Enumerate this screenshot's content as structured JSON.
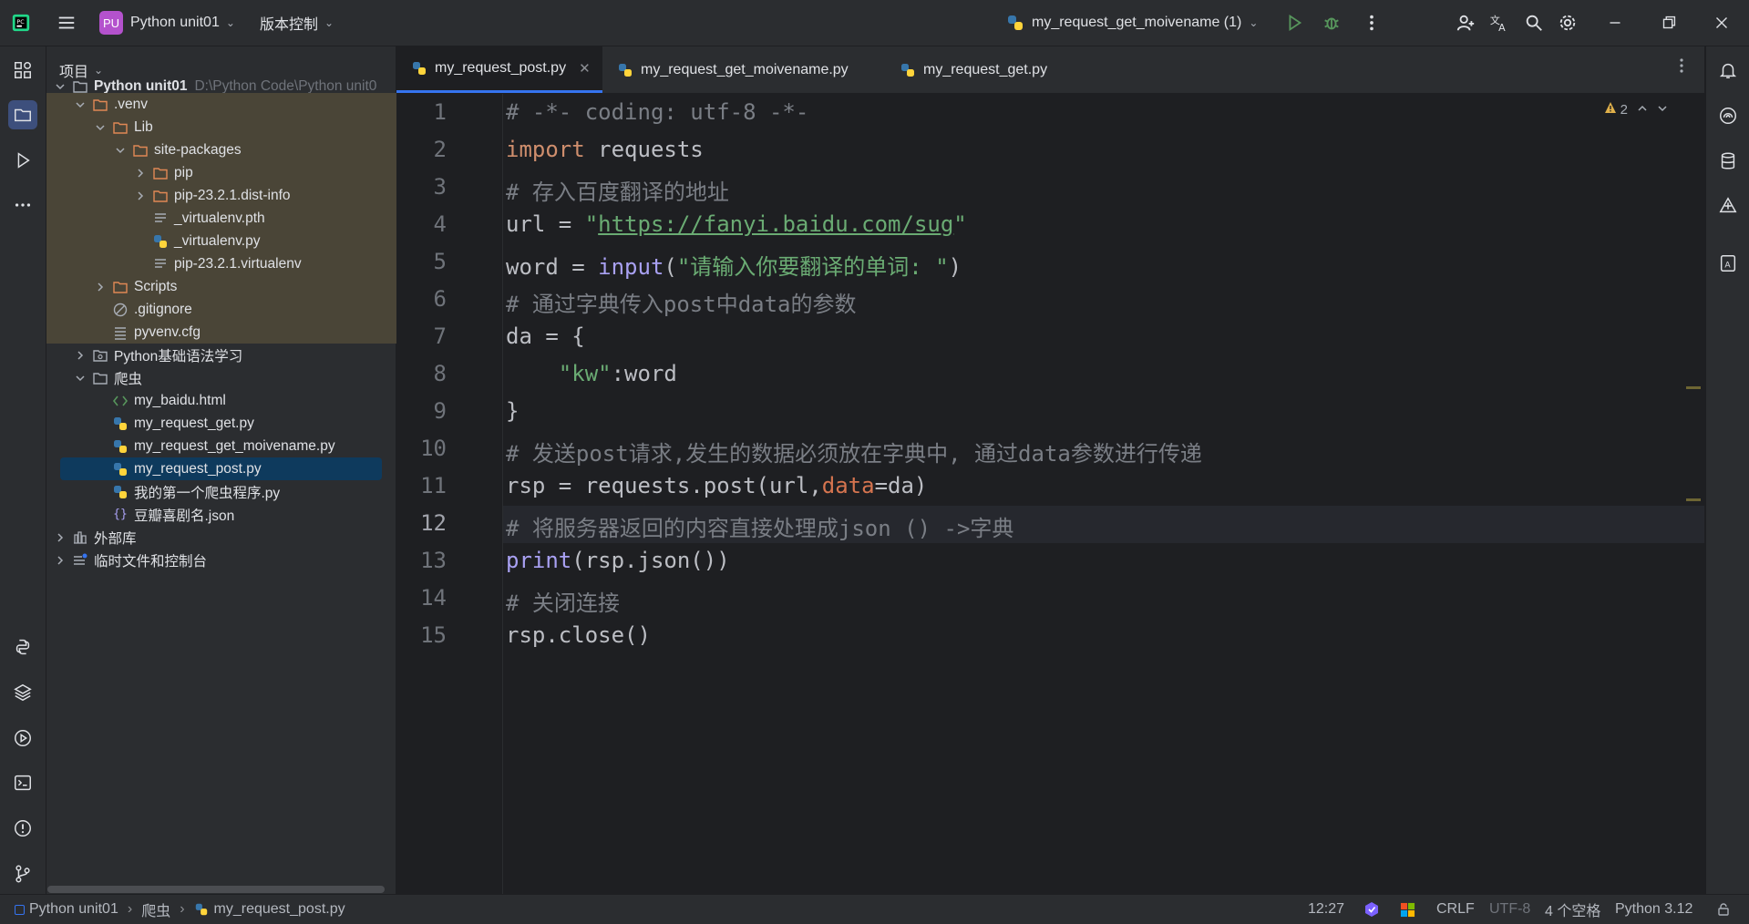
{
  "titlebar": {
    "project_badge": "PU",
    "project_name": "Python unit01",
    "vcs_label": "版本控制",
    "run_config": "my_request_get_moivename (1)"
  },
  "project_panel": {
    "title": "项目",
    "root_name": "Python unit01",
    "root_path": "D:\\Python Code\\Python unit0",
    "items": [
      {
        "label": ".venv"
      },
      {
        "label": "Lib"
      },
      {
        "label": "site-packages"
      },
      {
        "label": "pip"
      },
      {
        "label": "pip-23.2.1.dist-info"
      },
      {
        "label": "_virtualenv.pth"
      },
      {
        "label": "_virtualenv.py"
      },
      {
        "label": "pip-23.2.1.virtualenv"
      },
      {
        "label": "Scripts"
      },
      {
        "label": ".gitignore"
      },
      {
        "label": "pyvenv.cfg"
      },
      {
        "label": "Python基础语法学习"
      },
      {
        "label": "爬虫"
      },
      {
        "label": "my_baidu.html"
      },
      {
        "label": "my_request_get.py"
      },
      {
        "label": "my_request_get_moivename.py"
      },
      {
        "label": "my_request_post.py"
      },
      {
        "label": "我的第一个爬虫程序.py"
      },
      {
        "label": "豆瓣喜剧名.json"
      },
      {
        "label": "外部库"
      },
      {
        "label": "临时文件和控制台"
      }
    ]
  },
  "tabs": [
    {
      "label": "my_request_post.py"
    },
    {
      "label": "my_request_get_moivename.py"
    },
    {
      "label": "my_request_get.py"
    }
  ],
  "editor": {
    "warning_count": "2",
    "current_line": 12,
    "line_numbers": [
      "1",
      "2",
      "3",
      "4",
      "5",
      "6",
      "7",
      "8",
      "9",
      "10",
      "11",
      "12",
      "13",
      "14",
      "15"
    ],
    "lines": {
      "l1": "# -*- coding: utf-8 -*-",
      "l2_kw": "import",
      "l2_rest": " requests",
      "l3": "# 存入百度翻译的地址",
      "l4_a": "url = ",
      "l4_q1": "\"",
      "l4_url": "https://fanyi.baidu.com/sug",
      "l4_q2": "\"",
      "l5_a": "word = ",
      "l5_fn": "input",
      "l5_p1": "(",
      "l5_str": "\"请输入你要翻译的单词: \"",
      "l5_p2": ")",
      "l6": "# 通过字典传入post中data的参数",
      "l7": "da = {",
      "l8_indent": "    ",
      "l8_str": "\"kw\"",
      "l8_rest": ":word",
      "l9": "}",
      "l10": "# 发送post请求,发生的数据必须放在字典中, 通过data参数进行传递",
      "l11_a": "rsp = requests.post(url,",
      "l11_param": "data",
      "l11_b": "=da)",
      "l12": "# 将服务器返回的内容直接处理成json () ->字典",
      "l13_fn": "print",
      "l13_rest": "(rsp.json())",
      "l14": "# 关闭连接",
      "l15": "rsp.close()"
    }
  },
  "statusbar": {
    "breadcrumb": [
      "Python unit01",
      "爬虫",
      "my_request_post.py"
    ],
    "caret": "12:27",
    "line_sep": "CRLF",
    "encoding": "UTF-8",
    "indent": "4 个空格",
    "interpreter": "Python 3.12"
  }
}
